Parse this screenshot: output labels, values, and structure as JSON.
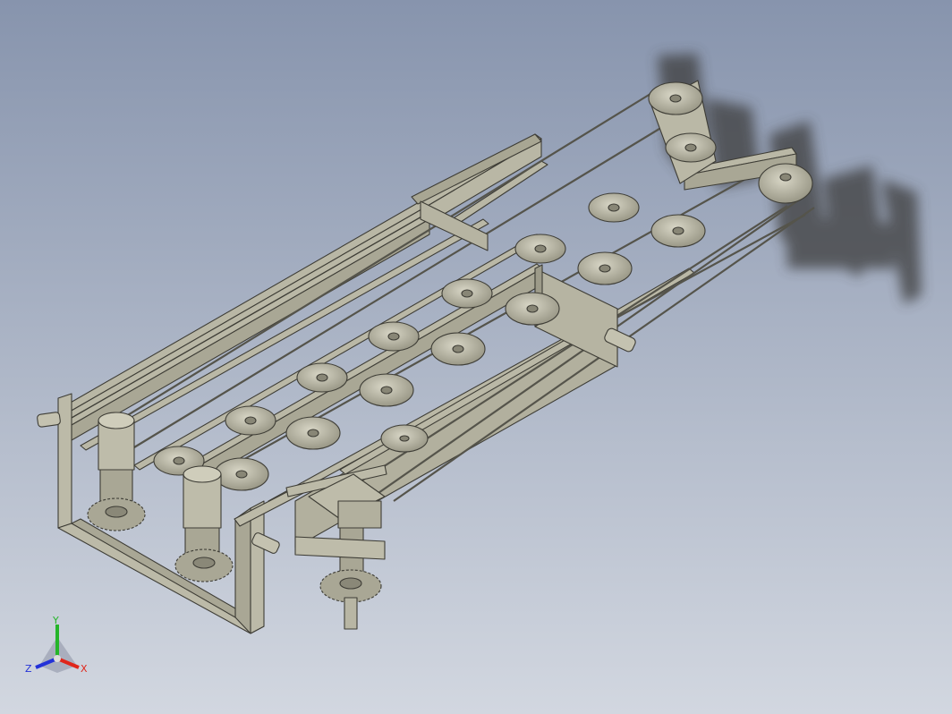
{
  "viewport": {
    "background_top": "#8794ad",
    "background_bottom": "#d2d7e0"
  },
  "model": {
    "steel_color": "#b8b6a4",
    "steel_dark": "#8f8d7c",
    "edge_color": "#3e3d36"
  },
  "view_triad": {
    "x_label": "X",
    "y_label": "Y",
    "z_label": "Z",
    "x_color": "#e0261b",
    "y_color": "#25b52a",
    "z_color": "#2332d8"
  }
}
